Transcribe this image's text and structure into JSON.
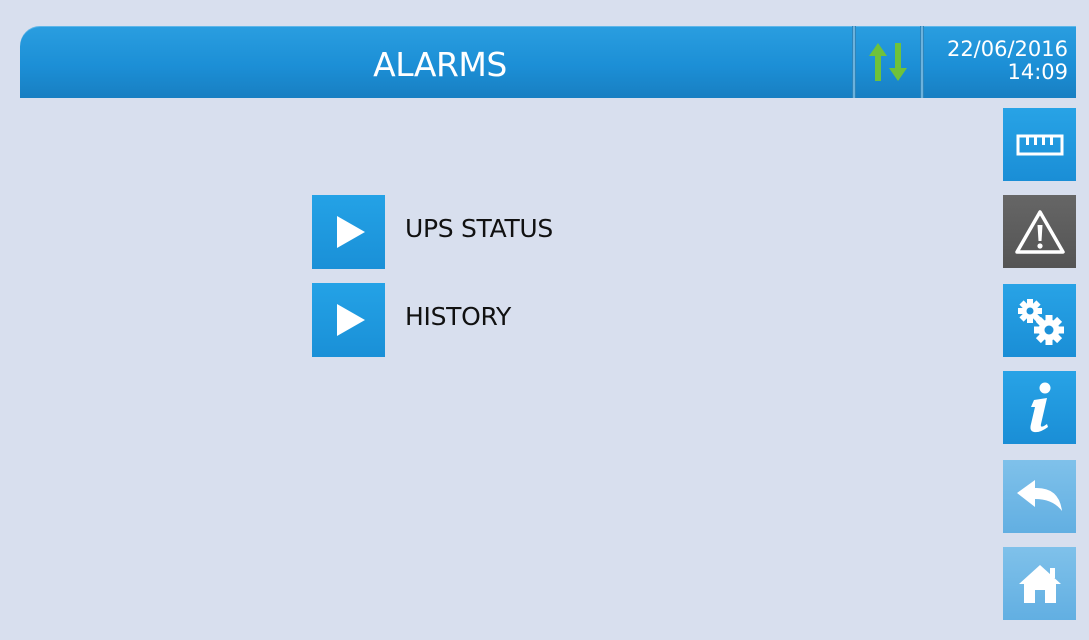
{
  "header": {
    "title": "ALARMS",
    "date": "22/06/2016",
    "time": "14:09",
    "comm_icon": "comm-arrows-icon"
  },
  "menu": {
    "items": [
      {
        "label": "UPS STATUS",
        "icon": "play-icon"
      },
      {
        "label": "HISTORY",
        "icon": "play-icon"
      }
    ]
  },
  "sidebar": {
    "buttons": [
      {
        "icon": "ruler-icon",
        "state": "normal"
      },
      {
        "icon": "warning-icon",
        "state": "active"
      },
      {
        "icon": "gears-icon",
        "state": "normal"
      },
      {
        "icon": "info-icon",
        "state": "normal"
      },
      {
        "icon": "back-icon",
        "state": "disabled"
      },
      {
        "icon": "home-icon",
        "state": "disabled"
      }
    ]
  },
  "colors": {
    "background": "#d8dfee",
    "accent_blue": "#1c8fd6",
    "active_gray": "#5a5a5a",
    "disabled_blue": "#70b8e6",
    "comm_green": "#6fc23a"
  }
}
